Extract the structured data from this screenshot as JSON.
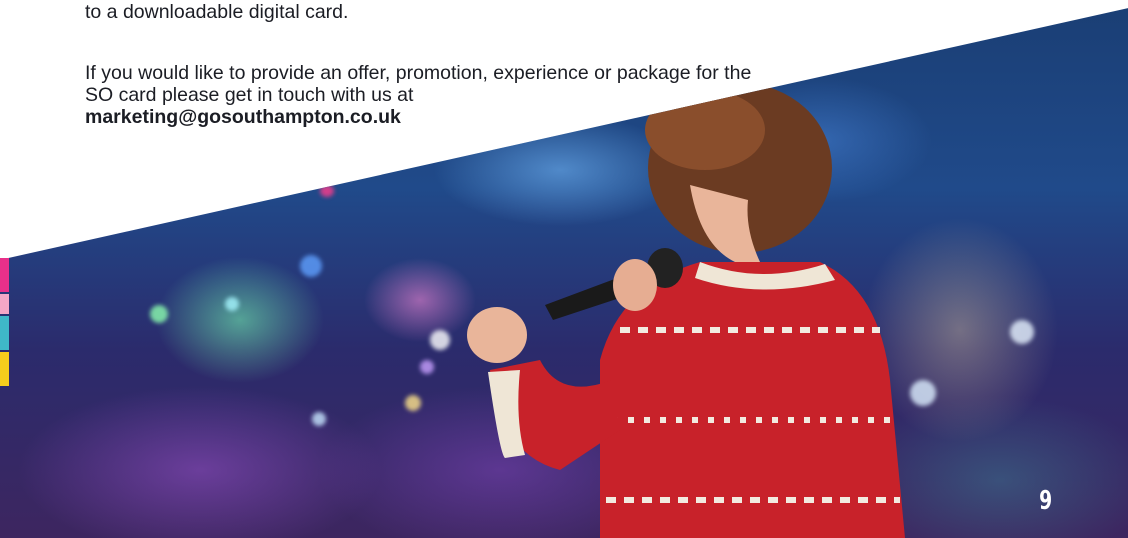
{
  "content": {
    "paragraph_1": "to a downloadable digital card.",
    "paragraph_2_text": "If you would like to provide an offer, promotion, experience or package for the SO card please get in touch with us at",
    "contact_email": "marketing@gosouthampton.co.uk"
  },
  "photo": {
    "subject": "singer-in-christmas-jumper-on-stage"
  },
  "edge_bars": {
    "colors": [
      "#e8308a",
      "#f4a7c6",
      "#3fb8c8",
      "#f6cd1c"
    ]
  },
  "footer": {
    "page_number": "9"
  },
  "colors": {
    "text": "#1b1d24",
    "page_number": "#ffffff"
  }
}
